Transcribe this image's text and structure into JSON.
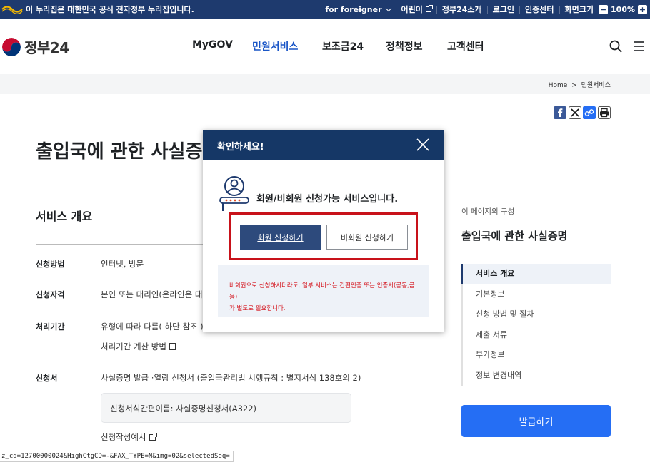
{
  "topbar": {
    "notice": "이 누리집은 대한민국 공식 전자정부 누리집입니다.",
    "links": [
      "for foreigner",
      "어린이",
      "정부24소개",
      "로그인",
      "인증센터",
      "화면크기"
    ],
    "zoom_minus": "−",
    "zoom_value": "100%",
    "zoom_plus": "+"
  },
  "header": {
    "logo_text": "정부24",
    "nav": [
      "MyGOV",
      "민원서비스",
      "보조금24",
      "정책정보",
      "고객센터"
    ],
    "active_nav": "민원서비스"
  },
  "breadcrumb": {
    "home": "Home",
    "current": "민원서비스",
    "sep": ">"
  },
  "page": {
    "title": "출입국에 관한 사실증명",
    "section_title": "서비스 개요",
    "rows": {
      "method_label": "신청방법",
      "method_value": "인터넷, 방문",
      "qual_label": "신청자격",
      "qual_value": "본인 또는 대리인(온라인은 대리",
      "period_label": "처리기간",
      "period_value": "유형에 따라 다름( 하단 참조 )",
      "period_link": "처리기간 계산 방법",
      "form_label": "신청서",
      "form_value": "사실증명 발급 ·열람 신청서 (출입국관리법 시행규칙 : 별지서식 138호의 2)",
      "form_box": "신청서식간편이름: 사실증명신청서(A322)",
      "form_example": "신청작성예시"
    }
  },
  "toc": {
    "caption": "이 페이지의 구성",
    "title": "출입국에 관한 사실증명",
    "items": [
      "서비스 개요",
      "기본정보",
      "신청 방법 및 절차",
      "제출 서류",
      "부가정보",
      "정보 변경내역"
    ],
    "apply": "발급하기"
  },
  "status_url": "z_cd=12700000024&HighCtgCD=-&FAX_TYPE=N&img=02&selectedSeq=",
  "modal": {
    "title": "확인하세요!",
    "message": "회원/비회원 신청가능 서비스입니다.",
    "member_button": "회원 신청하기",
    "nonmember_button": "비회원 신청하기",
    "notice_line1": "비회원으로 신청하시더라도, 일부 서비스는 간편인증 또는 인증서(공동,금융)",
    "notice_line2": "가 별도로 필요합니다."
  },
  "colors": {
    "topbar": "#1e3a6e",
    "accent": "#256ef4",
    "modal_header": "#153766",
    "highlight": "#c8121a"
  }
}
